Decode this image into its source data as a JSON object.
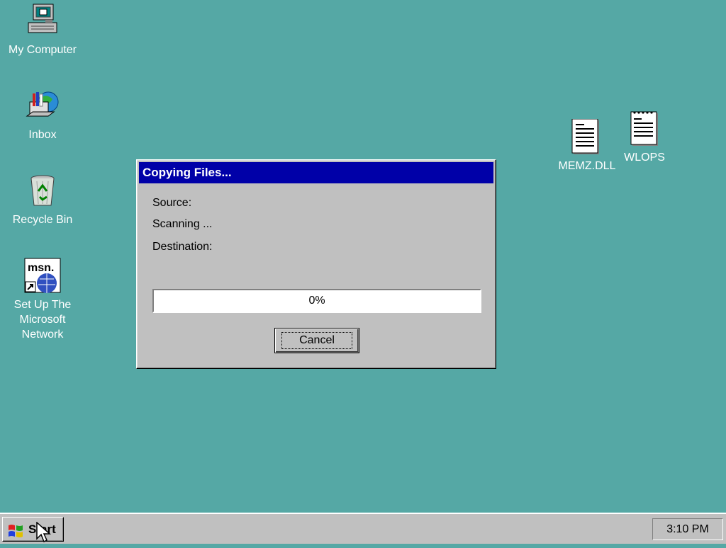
{
  "desktop": {
    "icons": [
      {
        "label": "My Computer",
        "icon": "my-computer-icon"
      },
      {
        "label": "Inbox",
        "icon": "inbox-icon"
      },
      {
        "label": "Recycle Bin",
        "icon": "recycle-bin-icon"
      },
      {
        "label": "Set Up The\nMicrosoft\nNetwork",
        "icon": "msn-icon"
      },
      {
        "label": "MEMZ.DLL",
        "icon": "document-icon"
      },
      {
        "label": "WLOPS",
        "icon": "notepad-icon"
      }
    ],
    "background_color": "#55a8a5"
  },
  "dialog": {
    "title": "Copying Files...",
    "source_label": "Source:",
    "status": "Scanning ...",
    "destination_label": "Destination:",
    "progress_text": "0%",
    "progress_fraction": 0,
    "cancel_label": "Cancel",
    "title_color": "#0000a8"
  },
  "taskbar": {
    "start_label": "Start",
    "clock": "3:10 PM"
  }
}
